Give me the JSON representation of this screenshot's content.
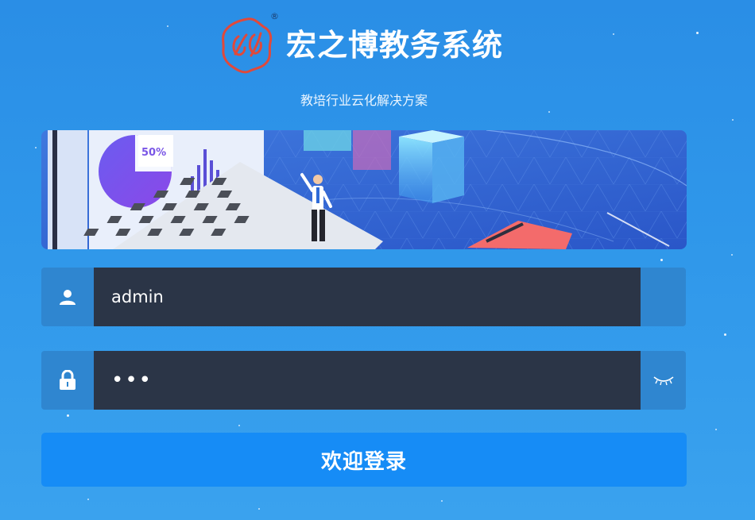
{
  "header": {
    "title": "宏之博教务系统",
    "subtitle": "教培行业云化解决方案",
    "logo_mark": "®"
  },
  "banner": {
    "icon": "laptop-analytics-illustration",
    "chart_badge": "50%"
  },
  "login_form": {
    "username_value": "admin",
    "password_value": "•••",
    "username_icon": "user-icon",
    "password_icon": "lock-icon",
    "visibility_icon": "eye-closed-icon",
    "submit_label": "欢迎登录"
  },
  "colors": {
    "background": "#2f97ea",
    "input_bg": "#2b3547",
    "button": "#168cf6"
  }
}
